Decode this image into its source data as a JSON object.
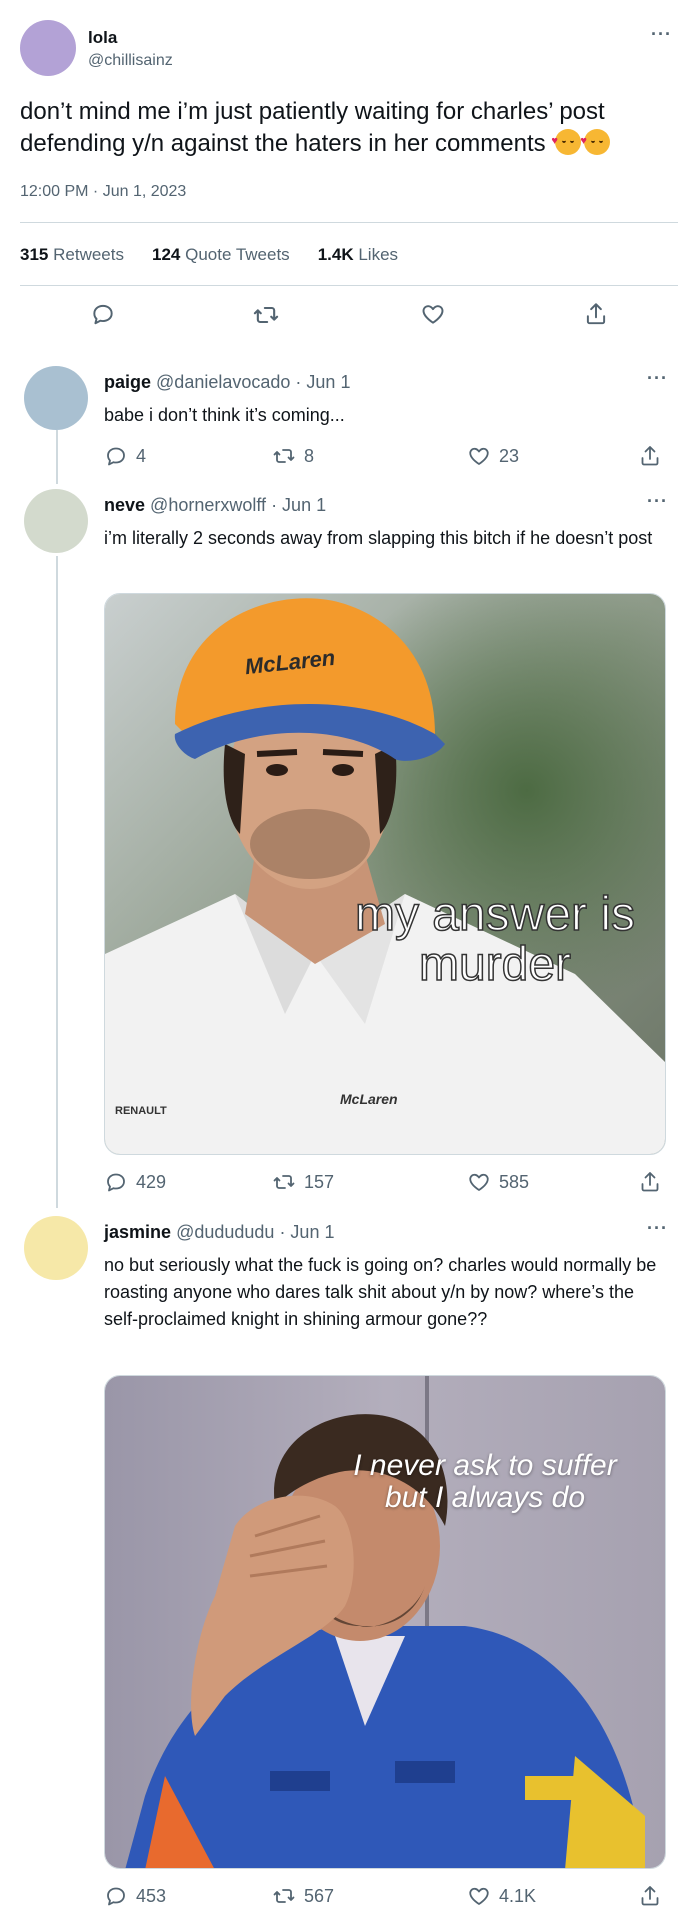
{
  "main_tweet": {
    "name": "lola",
    "handle": "@chillisainz",
    "text": "don’t mind me i’m just patiently waiting for charles’ post defending y/n against the haters in her comments",
    "emoji": "smiling-face-with-hearts emoji x2",
    "time": "12:00 PM · Jun 1, 2023",
    "retweets": "315",
    "retweets_label": "Retweets",
    "quotes": "124",
    "quotes_label": "Quote Tweets",
    "likes": "1.4K",
    "likes_label": "Likes",
    "more_icon": "more-icon",
    "avatar_color": "#b3a2d6"
  },
  "replies": [
    {
      "name": "paige",
      "handle": "@danielavocado",
      "date": "· Jun 1",
      "text": "babe i don’t think it’s coming...",
      "replies": "4",
      "retweets": "8",
      "likes": "23",
      "avatar_color": "#a9c0d1"
    },
    {
      "name": "neve",
      "handle": "@hornerxwolff",
      "date": "· Jun 1",
      "text": "i’m literally 2 seconds away from slapping this bitch if he doesn’t post",
      "media_caption": "my answer is murder",
      "media_cap_brand": "McLaren",
      "media_shirt_brand": "RENAULT",
      "replies": "429",
      "retweets": "157",
      "likes": "585",
      "avatar_color": "#d3dacd"
    },
    {
      "name": "jasmine",
      "handle": "@dudududu",
      "date": "· Jun 1",
      "text": "no but seriously what the fuck is going on? charles would normally be roasting anyone who dares talk shit about y/n by now? where’s the self-proclaimed knight in shining armour gone??",
      "media_caption_1": "I never ask to suffer",
      "media_caption_2": "but I always do",
      "replies": "453",
      "retweets": "567",
      "likes": "4.1K",
      "avatar_color": "#f6e8a8"
    }
  ],
  "colors": {
    "text": "#0f1419",
    "secondary": "#536471",
    "divider": "#cfd9de"
  }
}
